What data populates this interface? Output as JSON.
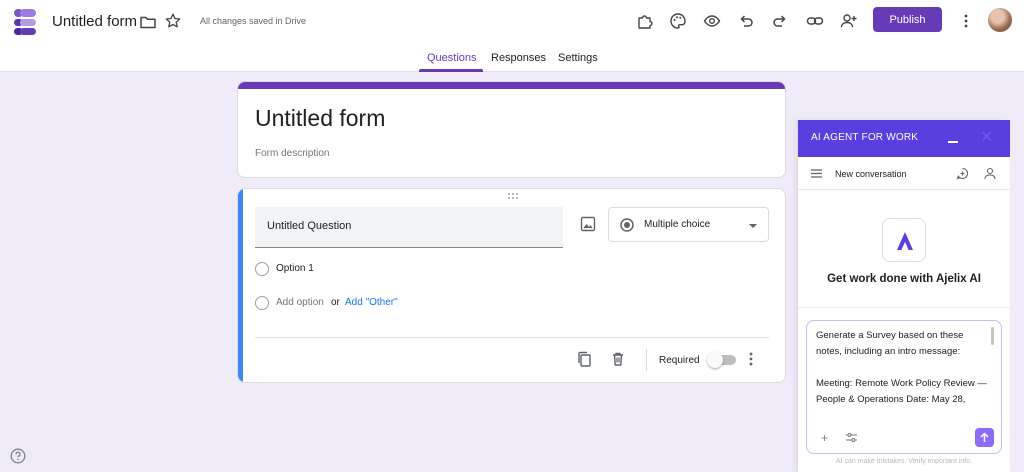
{
  "app": {
    "title": "Untitled form",
    "save_status": "All changes saved in Drive",
    "publish_label": "Publish",
    "icons": [
      "forms-logo-icon",
      "folder-icon",
      "star-icon",
      "addon-icon",
      "palette-icon",
      "preview-icon",
      "undo-icon",
      "redo-icon",
      "link-icon",
      "add-collaborator-icon",
      "more-vert-icon"
    ]
  },
  "tabs": [
    {
      "label": "Questions",
      "active": true
    },
    {
      "label": "Responses",
      "active": false
    },
    {
      "label": "Settings",
      "active": false
    }
  ],
  "form": {
    "title": "Untitled form",
    "description_placeholder": "Form description"
  },
  "question": {
    "title": "Untitled Question",
    "type": "Multiple choice",
    "options": [
      "Option 1"
    ],
    "add_option_label": "Add option",
    "or_label": "or",
    "add_other_label": "Add \"Other\"",
    "required_label": "Required",
    "required": false
  },
  "agent": {
    "header": "AI AGENT FOR WORK",
    "conversation_label": "New conversation",
    "tagline": "Get work done with Ajelix AI",
    "prompt": "Generate a Survey based on these notes, including an intro message:\n\nMeeting: Remote Work Policy Review — People & Operations Date: May 28,",
    "disclaimer": "AI can make mistakes. Verify important info."
  },
  "colors": {
    "accent": "#673ab7",
    "agent_header": "#5a3fe0",
    "question_highlight": "#4285f4",
    "link": "#1a73e8",
    "background": "#f0ebf8"
  }
}
